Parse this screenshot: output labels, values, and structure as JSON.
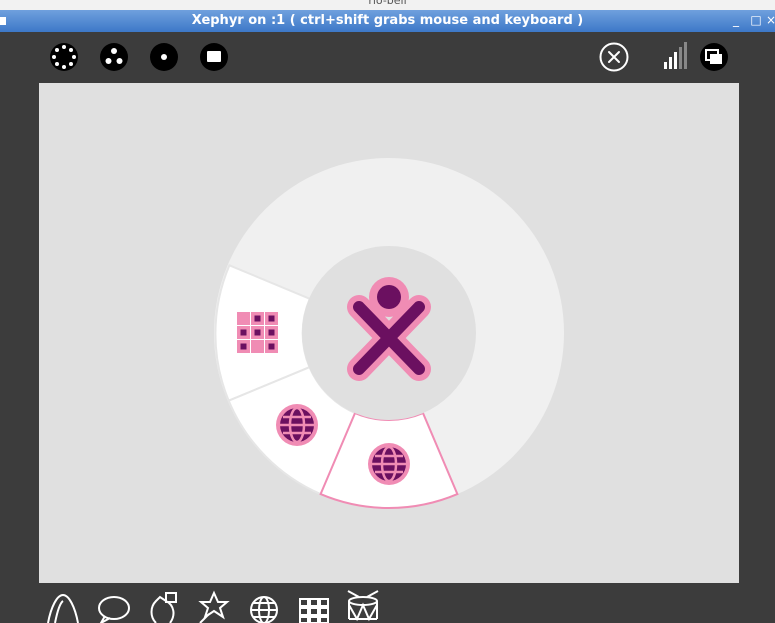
{
  "window": {
    "outer_title": "rlo-bell",
    "title": "Xephyr on :1 ( ctrl+shift grabs mouse and keyboard )",
    "minimize_glyph": "_",
    "maximize_glyph": "□",
    "close_glyph": "×"
  },
  "toolbar": {
    "zoom_views": [
      "neighborhood-icon",
      "group-icon",
      "home-icon",
      "activity-view-icon"
    ],
    "right": [
      "stop-icon",
      "network-signal-icon",
      "frame-toggle-icon"
    ]
  },
  "home_ring": {
    "center_icon": "xo-buddy-icon",
    "segments": [
      "grid-apps-icon",
      "browse-web-icon",
      "browse-web-icon"
    ],
    "selected_segment": 2,
    "colors": {
      "stroke": "#f08cb4",
      "fill": "#6b1060",
      "ring": "#f0f0f0",
      "segment": "#ffffff"
    }
  },
  "frame_icons": [
    "turtle-art-icon",
    "chat-icon",
    "record-icon",
    "paint-icon",
    "browse-icon",
    "grid-apps-icon",
    "drum-icon"
  ]
}
